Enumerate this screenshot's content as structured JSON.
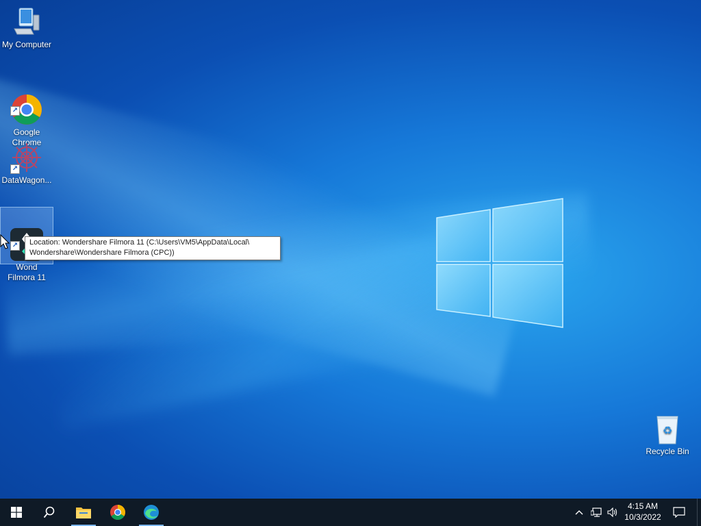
{
  "desktop": {
    "icons": [
      {
        "label": "My Computer"
      },
      {
        "label": "Google\nChrome"
      },
      {
        "label": "DataWagon..."
      },
      {
        "label": "Wond\nFilmora 11"
      },
      {
        "label": "Recycle Bin"
      }
    ],
    "tooltip": {
      "line1": "Location: Wondershare Filmora 11 (C:\\Users\\VM5\\AppData\\Local\\",
      "line2": "Wondershare\\Wondershare Filmora (CPC))"
    }
  },
  "taskbar": {
    "pinned": [
      {
        "icon": "windows-start-icon"
      },
      {
        "icon": "search-icon"
      },
      {
        "icon": "file-explorer-icon"
      },
      {
        "icon": "chrome-icon"
      },
      {
        "icon": "edge-icon"
      }
    ],
    "clock": {
      "time": "4:15 AM",
      "date": "10/3/2022"
    }
  },
  "colors": {
    "taskbar": "#0f1a26",
    "accent": "#0078d7"
  }
}
